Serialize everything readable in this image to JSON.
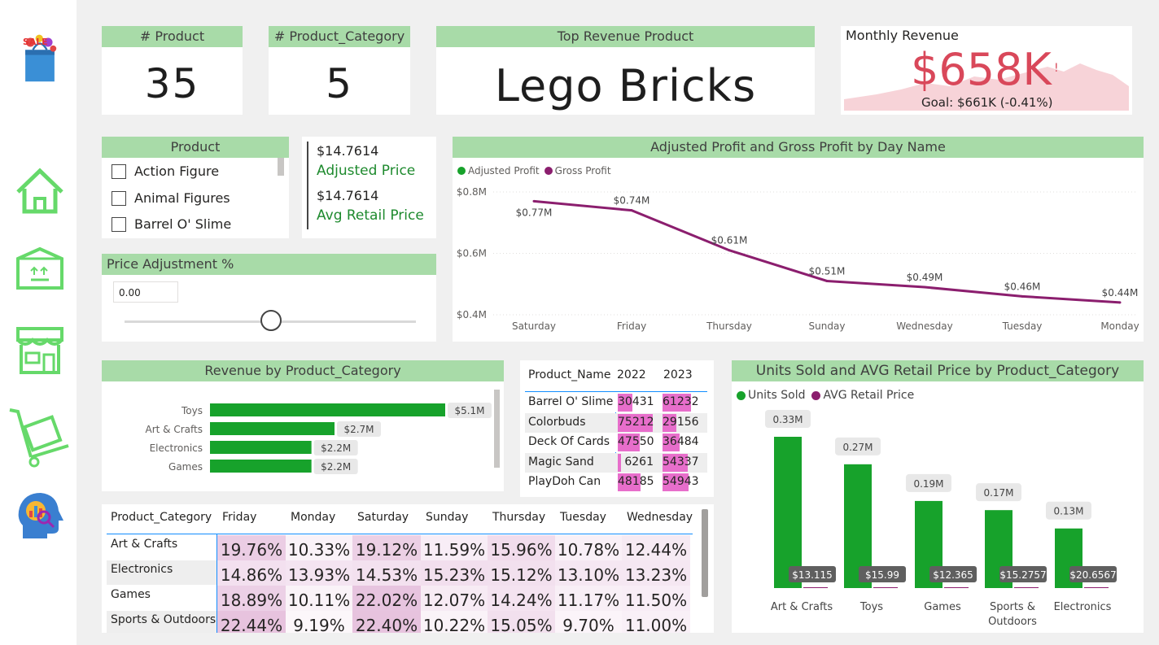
{
  "colors": {
    "header_bg": "#a8dba8",
    "green": "#17a22b",
    "purple": "#8b1e6e",
    "pink": "#e76ecb",
    "kpi_red": "#d9485a"
  },
  "sidebar": {
    "icons": [
      "sale-bag-icon",
      "home-icon",
      "box-icon",
      "store-icon",
      "hand-truck-icon",
      "head-analytics-icon"
    ]
  },
  "kpis": {
    "product_count": {
      "title": "# Product",
      "value": "35"
    },
    "category_count": {
      "title": "# Product_Category",
      "value": "5"
    },
    "top_product": {
      "title": "Top Revenue Product",
      "value": "Lego Bricks"
    },
    "monthly_revenue": {
      "title": "Monthly Revenue",
      "value": "$658K",
      "alert": "!",
      "goal": "Goal: $661K (-0.41%)"
    }
  },
  "product_slicer": {
    "title": "Product",
    "items": [
      "Action Figure",
      "Animal Figures",
      "Barrel O' Slime"
    ]
  },
  "price_card": {
    "adjusted_value": "$14.7614",
    "adjusted_label": "Adjusted Price",
    "avg_value": "$14.7614",
    "avg_label": "Avg Retail Price"
  },
  "price_adjust": {
    "title": "Price Adjustment %",
    "value": "0.00"
  },
  "profit_chart": {
    "title": "Adjusted Profit and Gross Profit by Day Name",
    "legend": [
      {
        "name": "Adjusted Profit",
        "color": "#17a22b"
      },
      {
        "name": "Gross Profit",
        "color": "#8b1e6e"
      }
    ]
  },
  "revenue_chart": {
    "title": "Revenue by Product_Category"
  },
  "product_table": {
    "headers": [
      "Product_Name",
      "2022",
      "2023"
    ],
    "rows": [
      {
        "name": "Barrel O' Slime",
        "y2022": "30431",
        "y2023": "61232",
        "f2022": 0.4,
        "f2023": 0.8
      },
      {
        "name": "Colorbuds",
        "y2022": "75212",
        "y2023": "29156",
        "f2022": 0.98,
        "f2023": 0.38
      },
      {
        "name": "Deck Of Cards",
        "y2022": "47550",
        "y2023": "36484",
        "f2022": 0.62,
        "f2023": 0.48
      },
      {
        "name": "Magic Sand",
        "y2022": "6261",
        "y2023": "54337",
        "f2022": 0.08,
        "f2023": 0.71
      },
      {
        "name": "PlayDoh Can",
        "y2022": "48185",
        "y2023": "54943",
        "f2022": 0.63,
        "f2023": 0.72
      }
    ]
  },
  "units_chart": {
    "title": "Units Sold and AVG Retail Price by Product_Category",
    "legend": [
      {
        "name": "Units Sold",
        "color": "#17a22b"
      },
      {
        "name": "AVG Retail Price",
        "color": "#8b1e6e"
      }
    ]
  },
  "matrix": {
    "headers": [
      "Product_Category",
      "Friday",
      "Monday",
      "Saturday",
      "Sunday",
      "Thursday",
      "Tuesday",
      "Wednesday"
    ],
    "rows": [
      {
        "cat": "Art & Crafts",
        "vals": [
          "19.76%",
          "10.33%",
          "19.12%",
          "11.59%",
          "15.96%",
          "10.78%",
          "12.44%"
        ]
      },
      {
        "cat": "Electronics",
        "vals": [
          "14.86%",
          "13.93%",
          "14.53%",
          "15.23%",
          "15.12%",
          "13.10%",
          "13.23%"
        ]
      },
      {
        "cat": "Games",
        "vals": [
          "18.89%",
          "10.11%",
          "22.02%",
          "12.07%",
          "14.24%",
          "11.17%",
          "11.50%"
        ]
      },
      {
        "cat": "Sports & Outdoors",
        "vals": [
          "22.44%",
          "9.19%",
          "22.40%",
          "10.22%",
          "15.05%",
          "9.70%",
          "11.00%"
        ]
      }
    ]
  },
  "chart_data": [
    {
      "type": "line",
      "title": "Adjusted Profit and Gross Profit by Day Name",
      "x": [
        "Saturday",
        "Friday",
        "Thursday",
        "Sunday",
        "Wednesday",
        "Tuesday",
        "Monday"
      ],
      "series": [
        {
          "name": "Gross Profit",
          "values": [
            0.77,
            0.74,
            0.61,
            0.51,
            0.49,
            0.46,
            0.44
          ],
          "labels": [
            "$0.77M",
            "$0.74M",
            "$0.61M",
            "$0.51M",
            "$0.49M",
            "$0.46M",
            "$0.44M"
          ]
        }
      ],
      "ylim": [
        0.4,
        0.8
      ],
      "yticks": [
        "$0.4M",
        "$0.6M",
        "$0.8M"
      ],
      "yticks_values": [
        0.4,
        0.6,
        0.8
      ]
    },
    {
      "type": "bar",
      "title": "Revenue by Product_Category",
      "categories": [
        "Toys",
        "Art & Crafts",
        "Electronics",
        "Games"
      ],
      "values": [
        5.1,
        2.7,
        2.2,
        2.2
      ],
      "labels": [
        "$5.1M",
        "$2.7M",
        "$2.2M",
        "$2.2M"
      ]
    },
    {
      "type": "bar",
      "title": "Units Sold and AVG Retail Price by Product_Category",
      "categories": [
        "Art & Crafts",
        "Toys",
        "Games",
        "Sports & Outdoors",
        "Electronics"
      ],
      "series": [
        {
          "name": "Units Sold",
          "values": [
            0.33,
            0.27,
            0.19,
            0.17,
            0.13
          ],
          "labels": [
            "0.33M",
            "0.27M",
            "0.19M",
            "0.17M",
            "0.13M"
          ]
        },
        {
          "name": "AVG Retail Price",
          "values": [
            13.115,
            15.99,
            12.365,
            15.2757,
            20.6567
          ],
          "labels": [
            "$13.115",
            "$15.99",
            "$12.365",
            "$15.2757",
            "$20.6567"
          ]
        }
      ]
    }
  ]
}
